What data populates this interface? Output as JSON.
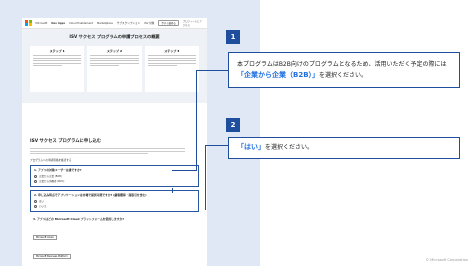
{
  "screenshot": {
    "topbar": {
      "brand": "Microsoft",
      "app": "Dev Apps",
      "nav": [
        "Cloud Enablement",
        "Marketplace",
        "サブスクリプション",
        "ISV 対象",
        "サポート"
      ],
      "button": "今すぐ始める",
      "right": "プロフィールにアクセス"
    },
    "hero": {
      "title": "ISV サクセス プログラムの申請プロセスの概要",
      "steps": [
        "ステップ 1",
        "ステップ 2",
        "ステップ 3"
      ]
    },
    "form": {
      "title": "ISV サクセス プログラムに申し込む",
      "required_label": "プログラムへの申請資格を確認する",
      "q1": {
        "title": "1. アプリの対象ユーザーは誰ですか?",
        "options": [
          "企業から企業 (B2B)",
          "企業から消費者 (B2C)"
        ]
      },
      "q2": {
        "title": "2. 申し込み時点でアプリケーションは市場で提供可能ですか? (顧客獲得・商取引を含む)",
        "options": [
          "はい",
          "いいえ"
        ]
      },
      "q3": {
        "title": "3. アプリはどの Microsoft Cloud プラットフォームを使用しますか?",
        "options": [
          "Microsoft Azure",
          "Microsoft Business Platform"
        ]
      }
    }
  },
  "callouts": [
    {
      "number": "1",
      "text_before": "本プログラムはB2B向けのプログラムとなるため、活用いただく予定の際には",
      "highlight": "「企業から企業（B2B）」",
      "text_after": "を選択ください。"
    },
    {
      "number": "2",
      "highlight": "「はい」",
      "text_after": "を選択ください。"
    }
  ],
  "copyright": "© Microsoft Corporation",
  "colors": {
    "accent": "#1f4e9c",
    "highlight": "#1f6fe0",
    "panel": "#dfe8f4"
  }
}
